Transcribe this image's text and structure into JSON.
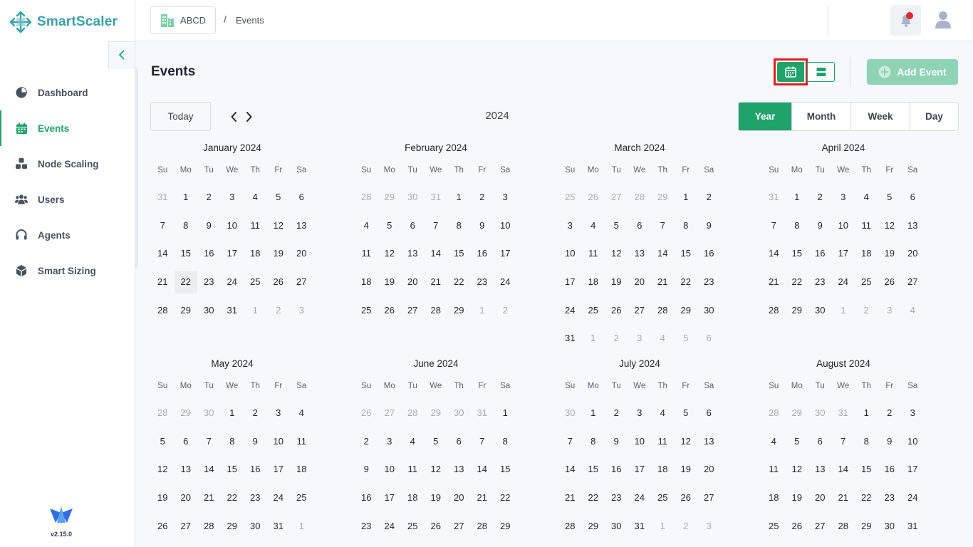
{
  "brand": {
    "name": "SmartScaler",
    "color": "#3aa0a7",
    "accent": "#1fa36b"
  },
  "version": "v2.15.0",
  "sidebar": {
    "items": [
      {
        "label": "Dashboard",
        "icon": "pie-chart-icon",
        "active": false
      },
      {
        "label": "Events",
        "icon": "calendar-icon",
        "active": true
      },
      {
        "label": "Node Scaling",
        "icon": "nodes-icon",
        "active": false
      },
      {
        "label": "Users",
        "icon": "users-icon",
        "active": false
      },
      {
        "label": "Agents",
        "icon": "headset-icon",
        "active": false
      },
      {
        "label": "Smart Sizing",
        "icon": "cube-icon",
        "active": false
      }
    ]
  },
  "header": {
    "org": "ABCD",
    "separator": "/",
    "page": "Events"
  },
  "main": {
    "title": "Events",
    "add_event_label": "Add Event",
    "today_label": "Today",
    "year": "2024",
    "views": [
      {
        "label": "Year",
        "active": true
      },
      {
        "label": "Month",
        "active": false
      },
      {
        "label": "Week",
        "active": false
      },
      {
        "label": "Day",
        "active": false
      }
    ],
    "dow": [
      "Su",
      "Mo",
      "Tu",
      "We",
      "Th",
      "Fr",
      "Sa"
    ],
    "today": {
      "month": 0,
      "day": 22
    },
    "months": [
      {
        "title": "January 2024",
        "weeks": [
          [
            "31",
            "1",
            "2",
            "3",
            "4",
            "5",
            "6"
          ],
          [
            "7",
            "8",
            "9",
            "10",
            "11",
            "12",
            "13"
          ],
          [
            "14",
            "15",
            "16",
            "17",
            "18",
            "19",
            "20"
          ],
          [
            "21",
            "22",
            "23",
            "24",
            "25",
            "26",
            "27"
          ],
          [
            "28",
            "29",
            "30",
            "31",
            "1",
            "2",
            "3"
          ]
        ],
        "lead": 1,
        "trail": 3
      },
      {
        "title": "February 2024",
        "weeks": [
          [
            "28",
            "29",
            "30",
            "31",
            "1",
            "2",
            "3"
          ],
          [
            "4",
            "5",
            "6",
            "7",
            "8",
            "9",
            "10"
          ],
          [
            "11",
            "12",
            "13",
            "14",
            "15",
            "16",
            "17"
          ],
          [
            "18",
            "19",
            "20",
            "21",
            "22",
            "23",
            "24"
          ],
          [
            "25",
            "26",
            "27",
            "28",
            "29",
            "1",
            "2"
          ]
        ],
        "lead": 4,
        "trail": 2
      },
      {
        "title": "March 2024",
        "weeks": [
          [
            "25",
            "26",
            "27",
            "28",
            "29",
            "1",
            "2"
          ],
          [
            "3",
            "4",
            "5",
            "6",
            "7",
            "8",
            "9"
          ],
          [
            "10",
            "11",
            "12",
            "13",
            "14",
            "15",
            "16"
          ],
          [
            "17",
            "18",
            "19",
            "20",
            "21",
            "22",
            "23"
          ],
          [
            "24",
            "25",
            "26",
            "27",
            "28",
            "29",
            "30"
          ],
          [
            "31",
            "1",
            "2",
            "3",
            "4",
            "5",
            "6"
          ]
        ],
        "lead": 5,
        "trail": 6
      },
      {
        "title": "April 2024",
        "weeks": [
          [
            "31",
            "1",
            "2",
            "3",
            "4",
            "5",
            "6"
          ],
          [
            "7",
            "8",
            "9",
            "10",
            "11",
            "12",
            "13"
          ],
          [
            "14",
            "15",
            "16",
            "17",
            "18",
            "19",
            "20"
          ],
          [
            "21",
            "22",
            "23",
            "24",
            "25",
            "26",
            "27"
          ],
          [
            "28",
            "29",
            "30",
            "1",
            "2",
            "3",
            "4"
          ]
        ],
        "lead": 1,
        "trail": 4
      },
      {
        "title": "May 2024",
        "weeks": [
          [
            "28",
            "29",
            "30",
            "1",
            "2",
            "3",
            "4"
          ],
          [
            "5",
            "6",
            "7",
            "8",
            "9",
            "10",
            "11"
          ],
          [
            "12",
            "13",
            "14",
            "15",
            "16",
            "17",
            "18"
          ],
          [
            "19",
            "20",
            "21",
            "22",
            "23",
            "24",
            "25"
          ],
          [
            "26",
            "27",
            "28",
            "29",
            "30",
            "31",
            "1"
          ]
        ],
        "lead": 3,
        "trail": 1
      },
      {
        "title": "June 2024",
        "weeks": [
          [
            "26",
            "27",
            "28",
            "29",
            "30",
            "31",
            "1"
          ],
          [
            "2",
            "3",
            "4",
            "5",
            "6",
            "7",
            "8"
          ],
          [
            "9",
            "10",
            "11",
            "12",
            "13",
            "14",
            "15"
          ],
          [
            "16",
            "17",
            "18",
            "19",
            "20",
            "21",
            "22"
          ],
          [
            "23",
            "24",
            "25",
            "26",
            "27",
            "28",
            "29"
          ]
        ],
        "lead": 6,
        "trail": 0
      },
      {
        "title": "July 2024",
        "weeks": [
          [
            "30",
            "1",
            "2",
            "3",
            "4",
            "5",
            "6"
          ],
          [
            "7",
            "8",
            "9",
            "10",
            "11",
            "12",
            "13"
          ],
          [
            "14",
            "15",
            "16",
            "17",
            "18",
            "19",
            "20"
          ],
          [
            "21",
            "22",
            "23",
            "24",
            "25",
            "26",
            "27"
          ],
          [
            "28",
            "29",
            "30",
            "31",
            "1",
            "2",
            "3"
          ]
        ],
        "lead": 1,
        "trail": 3
      },
      {
        "title": "August 2024",
        "weeks": [
          [
            "28",
            "29",
            "30",
            "31",
            "1",
            "2",
            "3"
          ],
          [
            "4",
            "5",
            "6",
            "7",
            "8",
            "9",
            "10"
          ],
          [
            "11",
            "12",
            "13",
            "14",
            "15",
            "16",
            "17"
          ],
          [
            "18",
            "19",
            "20",
            "21",
            "22",
            "23",
            "24"
          ],
          [
            "25",
            "26",
            "27",
            "28",
            "29",
            "30",
            "31"
          ]
        ],
        "lead": 4,
        "trail": 0
      }
    ]
  }
}
